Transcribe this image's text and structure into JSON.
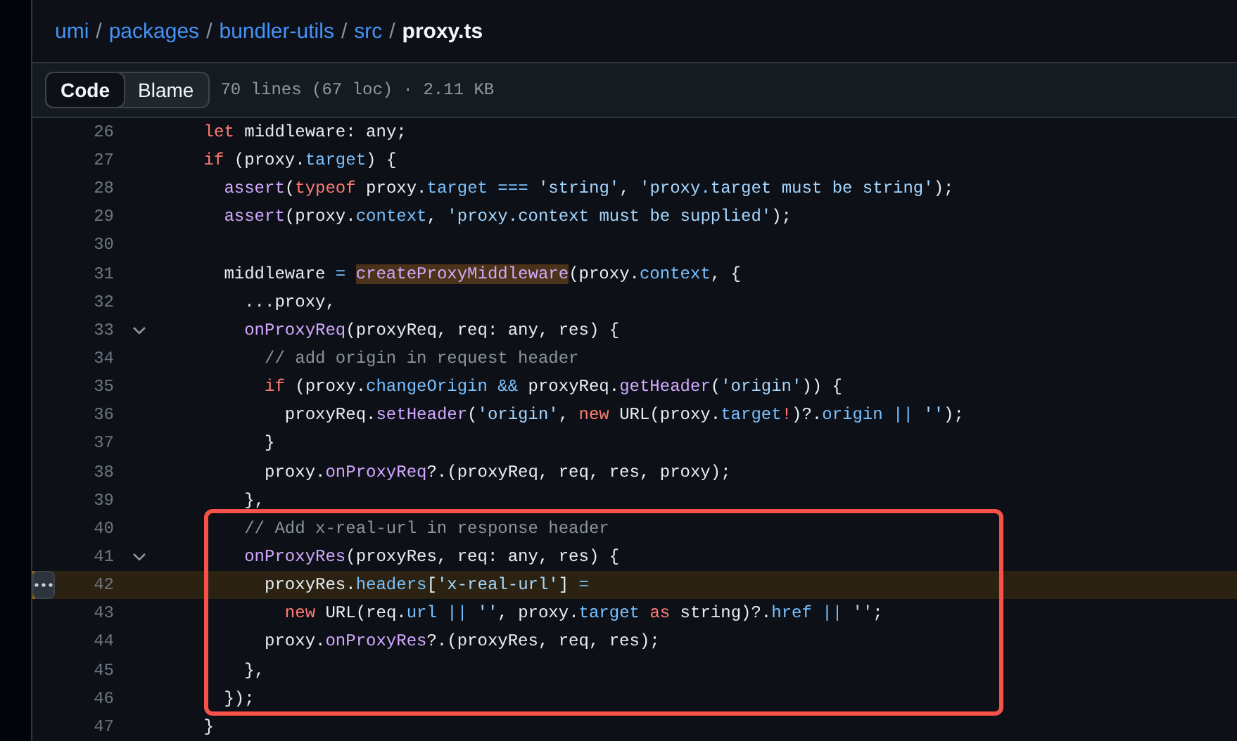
{
  "breadcrumb": {
    "links": [
      "umi",
      "packages",
      "bundler-utils",
      "src"
    ],
    "separator": "/",
    "current": "proxy.ts"
  },
  "view_tabs": [
    {
      "label": "Code",
      "selected": true
    },
    {
      "label": "Blame",
      "selected": false
    }
  ],
  "file_info": "70 lines (67 loc) · 2.11 KB",
  "code_blocks": [
    {
      "kind": "plain",
      "lines": [
        {
          "number": "26",
          "foldable": false,
          "current": false,
          "tokens": [
            {
              "kind": "keyword",
              "text": "    let"
            },
            {
              "kind": "plain",
              "text": " middleware: any;"
            }
          ]
        },
        {
          "number": "27",
          "foldable": false,
          "current": false,
          "tokens": [
            {
              "kind": "keyword",
              "text": "    if"
            },
            {
              "kind": "plain",
              "text": " (proxy."
            },
            {
              "kind": "property",
              "text": "target"
            },
            {
              "kind": "plain",
              "text": ") {"
            }
          ]
        },
        {
          "number": "28",
          "foldable": false,
          "current": false,
          "tokens": [
            {
              "kind": "function",
              "text": "      assert"
            },
            {
              "kind": "plain",
              "text": "("
            },
            {
              "kind": "keyword",
              "text": "typeof"
            },
            {
              "kind": "plain",
              "text": " proxy."
            },
            {
              "kind": "property",
              "text": "target ==="
            },
            {
              "kind": "string",
              "text": " 'string'"
            },
            {
              "kind": "plain",
              "text": ", "
            },
            {
              "kind": "string",
              "text": "'proxy.target must be string'"
            },
            {
              "kind": "plain",
              "text": ");"
            }
          ]
        },
        {
          "number": "29",
          "foldable": false,
          "current": false,
          "tokens": [
            {
              "kind": "function",
              "text": "      assert"
            },
            {
              "kind": "plain",
              "text": "(proxy."
            },
            {
              "kind": "property",
              "text": "context"
            },
            {
              "kind": "plain",
              "text": ", "
            },
            {
              "kind": "string",
              "text": "'proxy.context must be supplied'"
            },
            {
              "kind": "plain",
              "text": ");"
            }
          ]
        },
        {
          "number": "30",
          "foldable": false,
          "current": false
        },
        {
          "number": "31",
          "foldable": false,
          "current": false,
          "tokens": [
            {
              "kind": "plain",
              "text": "      middleware "
            },
            {
              "kind": "property",
              "text": "= "
            },
            {
              "kind": "function",
              "text": "createProxyMiddleware",
              "highlighted": true
            },
            {
              "kind": "plain",
              "text": "(proxy."
            },
            {
              "kind": "property",
              "text": "context"
            },
            {
              "kind": "plain",
              "text": ", {"
            }
          ]
        },
        {
          "number": "32",
          "foldable": false,
          "current": false,
          "tokens": [
            {
              "kind": "plain",
              "text": "        ...proxy,"
            }
          ]
        },
        {
          "number": "33",
          "foldable": true,
          "current": false,
          "tokens": [
            {
              "kind": "function",
              "text": "        onProxyReq"
            },
            {
              "kind": "plain",
              "text": "(proxyReq, req: any, res) {"
            }
          ]
        },
        {
          "number": "34",
          "foldable": false,
          "current": false,
          "tokens": [
            {
              "kind": "comment",
              "text": "          // add origin in request header"
            }
          ]
        },
        {
          "number": "35",
          "foldable": false,
          "current": false,
          "tokens": [
            {
              "kind": "keyword",
              "text": "          if"
            },
            {
              "kind": "plain",
              "text": " (proxy."
            },
            {
              "kind": "property",
              "text": "changeOrigin &&"
            },
            {
              "kind": "plain",
              "text": " proxyReq."
            },
            {
              "kind": "function",
              "text": "getHeader"
            },
            {
              "kind": "plain",
              "text": "("
            },
            {
              "kind": "string",
              "text": "'origin'"
            },
            {
              "kind": "plain",
              "text": ")) {"
            }
          ]
        },
        {
          "number": "36",
          "foldable": false,
          "current": false,
          "tokens": [
            {
              "kind": "plain",
              "text": "            proxyReq."
            },
            {
              "kind": "function",
              "text": "setHeader"
            },
            {
              "kind": "plain",
              "text": "("
            },
            {
              "kind": "string",
              "text": "'origin'"
            },
            {
              "kind": "plain",
              "text": ", "
            },
            {
              "kind": "keyword",
              "text": "new"
            },
            {
              "kind": "plain",
              "text": " URL(proxy."
            },
            {
              "kind": "property",
              "text": "target"
            },
            {
              "kind": "keyword",
              "text": "!"
            },
            {
              "kind": "plain",
              "text": ")?."
            },
            {
              "kind": "property",
              "text": "origin ||"
            },
            {
              "kind": "string",
              "text": " ''"
            },
            {
              "kind": "plain",
              "text": ");"
            }
          ]
        },
        {
          "number": "37",
          "foldable": false,
          "current": false,
          "tokens": [
            {
              "kind": "plain",
              "text": "          }"
            }
          ]
        },
        {
          "number": "38",
          "foldable": false,
          "current": false,
          "tokens": [
            {
              "kind": "plain",
              "text": "          proxy."
            },
            {
              "kind": "function",
              "text": "onProxyReq"
            },
            {
              "kind": "plain",
              "text": "?.(proxyReq, req, res, proxy);"
            }
          ]
        },
        {
          "number": "39",
          "foldable": false,
          "current": false,
          "tokens": [
            {
              "kind": "plain",
              "text": "        },"
            }
          ]
        }
      ]
    },
    {
      "kind": "boxed",
      "lines": [
        {
          "number": "40",
          "foldable": false,
          "current": false,
          "tokens": [
            {
              "kind": "comment",
              "text": "        // Add x-real-url in response header"
            }
          ]
        },
        {
          "number": "41",
          "foldable": true,
          "current": false,
          "tokens": [
            {
              "kind": "function",
              "text": "        onProxyRes"
            },
            {
              "kind": "plain",
              "text": "(proxyRes, req: any, res) {"
            }
          ]
        },
        {
          "number": "42",
          "foldable": false,
          "current": true,
          "tokens": [
            {
              "kind": "plain",
              "text": "          proxyRes."
            },
            {
              "kind": "property",
              "text": "headers"
            },
            {
              "kind": "plain",
              "text": "["
            },
            {
              "kind": "string",
              "text": "'x-real-url'"
            },
            {
              "kind": "plain",
              "text": "] "
            },
            {
              "kind": "property",
              "text": "="
            }
          ]
        },
        {
          "number": "43",
          "foldable": false,
          "current": false,
          "tokens": [
            {
              "kind": "keyword",
              "text": "            new"
            },
            {
              "kind": "plain",
              "text": " URL(req."
            },
            {
              "kind": "property",
              "text": "url ||"
            },
            {
              "kind": "string",
              "text": " ''"
            },
            {
              "kind": "plain",
              "text": ", proxy."
            },
            {
              "kind": "property",
              "text": "target"
            },
            {
              "kind": "keyword",
              "text": " as"
            },
            {
              "kind": "plain",
              "text": " string)?."
            },
            {
              "kind": "property",
              "text": "href ||"
            },
            {
              "kind": "string",
              "text": " ''"
            },
            {
              "kind": "plain",
              "text": ";"
            }
          ]
        },
        {
          "number": "44",
          "foldable": false,
          "current": false,
          "tokens": [
            {
              "kind": "plain",
              "text": "          proxy."
            },
            {
              "kind": "function",
              "text": "onProxyRes"
            },
            {
              "kind": "plain",
              "text": "?.(proxyRes, req, res);"
            }
          ]
        },
        {
          "number": "45",
          "foldable": false,
          "current": false,
          "tokens": [
            {
              "kind": "plain",
              "text": "        },"
            }
          ]
        },
        {
          "number": "46",
          "foldable": false,
          "current": false,
          "tokens": [
            {
              "kind": "plain",
              "text": "      });"
            }
          ]
        }
      ]
    },
    {
      "kind": "plain",
      "lines": [
        {
          "number": "47",
          "foldable": false,
          "current": false,
          "tokens": [
            {
              "kind": "plain",
              "text": "    }"
            }
          ]
        }
      ]
    }
  ]
}
